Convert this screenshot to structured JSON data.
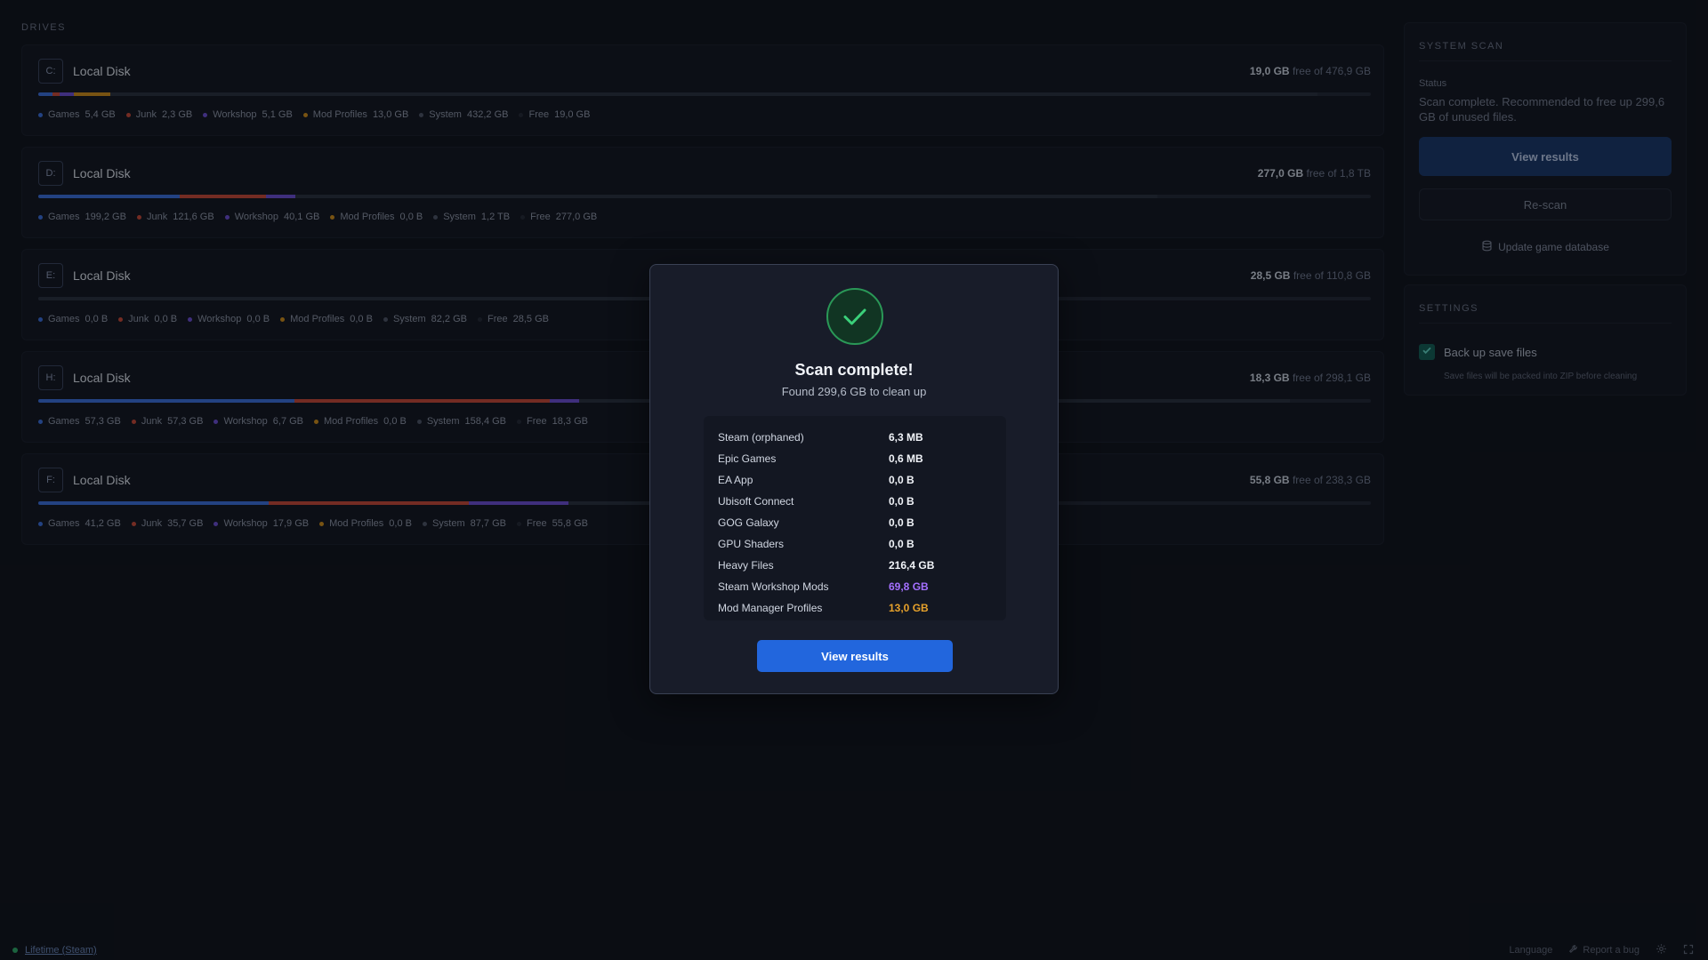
{
  "drives_section": {
    "label": "DRIVES"
  },
  "drives": [
    {
      "letter": "C:",
      "name": "Local Disk",
      "free_amount": "19,0 GB",
      "free_suffix": "free of 476,9 GB",
      "used_fraction": 0.96,
      "segments": [
        {
          "color": "#3b6fd9",
          "pct": 1.1
        },
        {
          "color": "#c24a3b",
          "pct": 0.5
        },
        {
          "color": "#6a4fd0",
          "pct": 1.1
        },
        {
          "color": "#c88a1e",
          "pct": 2.7
        },
        {
          "color": "#2b3242",
          "pct": 90.6
        }
      ],
      "legend": [
        {
          "label": "Games",
          "value": "5,4 GB",
          "color": "#3b6fd9"
        },
        {
          "label": "Junk",
          "value": "2,3 GB",
          "color": "#c24a3b"
        },
        {
          "label": "Workshop",
          "value": "5,1 GB",
          "color": "#6a4fd0"
        },
        {
          "label": "Mod Profiles",
          "value": "13,0 GB",
          "color": "#c88a1e"
        },
        {
          "label": "System",
          "value": "432,2 GB",
          "color": "#4d5568"
        },
        {
          "label": "Free",
          "value": "19,0 GB",
          "color": "#262c3a"
        }
      ]
    },
    {
      "letter": "D:",
      "name": "Local Disk",
      "free_amount": "277,0 GB",
      "free_suffix": "free of 1,8 TB",
      "used_fraction": 0.85,
      "segments": [
        {
          "color": "#3b6fd9",
          "pct": 10.6
        },
        {
          "color": "#c24a3b",
          "pct": 6.5
        },
        {
          "color": "#6a4fd0",
          "pct": 2.2
        },
        {
          "color": "#2b3242",
          "pct": 64.7
        }
      ],
      "legend": [
        {
          "label": "Games",
          "value": "199,2 GB",
          "color": "#3b6fd9"
        },
        {
          "label": "Junk",
          "value": "121,6 GB",
          "color": "#c24a3b"
        },
        {
          "label": "Workshop",
          "value": "40,1 GB",
          "color": "#6a4fd0"
        },
        {
          "label": "Mod Profiles",
          "value": "0,0 B",
          "color": "#c88a1e"
        },
        {
          "label": "System",
          "value": "1,2 TB",
          "color": "#4d5568"
        },
        {
          "label": "Free",
          "value": "277,0 GB",
          "color": "#262c3a"
        }
      ]
    },
    {
      "letter": "E:",
      "name": "Local Disk",
      "free_amount": "28,5 GB",
      "free_suffix": "free of 110,8 GB",
      "used_fraction": 0.74,
      "segments": [
        {
          "color": "#2b3242",
          "pct": 74.3
        }
      ],
      "legend": [
        {
          "label": "Games",
          "value": "0,0 B",
          "color": "#3b6fd9"
        },
        {
          "label": "Junk",
          "value": "0,0 B",
          "color": "#c24a3b"
        },
        {
          "label": "Workshop",
          "value": "0,0 B",
          "color": "#6a4fd0"
        },
        {
          "label": "Mod Profiles",
          "value": "0,0 B",
          "color": "#c88a1e"
        },
        {
          "label": "System",
          "value": "82,2 GB",
          "color": "#4d5568"
        },
        {
          "label": "Free",
          "value": "28,5 GB",
          "color": "#262c3a"
        }
      ]
    },
    {
      "letter": "H:",
      "name": "Local Disk",
      "free_amount": "18,3 GB",
      "free_suffix": "free of 298,1 GB",
      "used_fraction": 0.94,
      "segments": [
        {
          "color": "#3b6fd9",
          "pct": 19.2
        },
        {
          "color": "#c24a3b",
          "pct": 19.2
        },
        {
          "color": "#6a4fd0",
          "pct": 2.2
        },
        {
          "color": "#2b3242",
          "pct": 53.3
        }
      ],
      "legend": [
        {
          "label": "Games",
          "value": "57,3 GB",
          "color": "#3b6fd9"
        },
        {
          "label": "Junk",
          "value": "57,3 GB",
          "color": "#c24a3b"
        },
        {
          "label": "Workshop",
          "value": "6,7 GB",
          "color": "#6a4fd0"
        },
        {
          "label": "Mod Profiles",
          "value": "0,0 B",
          "color": "#c88a1e"
        },
        {
          "label": "System",
          "value": "158,4 GB",
          "color": "#4d5568"
        },
        {
          "label": "Free",
          "value": "18,3 GB",
          "color": "#262c3a"
        }
      ]
    },
    {
      "letter": "F:",
      "name": "Local Disk",
      "free_amount": "55,8 GB",
      "free_suffix": "free of 238,3 GB",
      "used_fraction": 0.77,
      "segments": [
        {
          "color": "#3b6fd9",
          "pct": 17.3
        },
        {
          "color": "#c24a3b",
          "pct": 15.0
        },
        {
          "color": "#6a4fd0",
          "pct": 7.5
        },
        {
          "color": "#2b3242",
          "pct": 36.8
        }
      ],
      "legend": [
        {
          "label": "Games",
          "value": "41,2 GB",
          "color": "#3b6fd9"
        },
        {
          "label": "Junk",
          "value": "35,7 GB",
          "color": "#c24a3b"
        },
        {
          "label": "Workshop",
          "value": "17,9 GB",
          "color": "#6a4fd0"
        },
        {
          "label": "Mod Profiles",
          "value": "0,0 B",
          "color": "#c88a1e"
        },
        {
          "label": "System",
          "value": "87,7 GB",
          "color": "#4d5568"
        },
        {
          "label": "Free",
          "value": "55,8 GB",
          "color": "#262c3a"
        }
      ]
    }
  ],
  "system_scan": {
    "label": "SYSTEM SCAN",
    "status_label": "Status",
    "status_text": "Scan complete. Recommended to free up 299,6 GB of unused files.",
    "view_results_label": "View results",
    "rescan_label": "Re-scan",
    "update_db_label": "Update game database"
  },
  "settings": {
    "label": "SETTINGS",
    "backup_label": "Back up save files",
    "backup_checked": true,
    "backup_desc": "Save files will be packed into ZIP before cleaning"
  },
  "footer": {
    "lifetime_label": "Lifetime (Steam)",
    "language_label": "Language",
    "report_bug_label": "Report a bug"
  },
  "modal": {
    "title": "Scan complete!",
    "subtitle": "Found 299,6 GB to clean up",
    "results": [
      {
        "name": "Steam (orphaned)",
        "value": "6,3 MB",
        "color": "#f1f4f9"
      },
      {
        "name": "Epic Games",
        "value": "0,6 MB",
        "color": "#f1f4f9"
      },
      {
        "name": "EA App",
        "value": "0,0 B",
        "color": "#f1f4f9"
      },
      {
        "name": "Ubisoft Connect",
        "value": "0,0 B",
        "color": "#f1f4f9"
      },
      {
        "name": "GOG Galaxy",
        "value": "0,0 B",
        "color": "#f1f4f9"
      },
      {
        "name": "GPU Shaders",
        "value": "0,0 B",
        "color": "#f1f4f9"
      },
      {
        "name": "Heavy Files",
        "value": "216,4 GB",
        "color": "#f1f4f9"
      },
      {
        "name": "Steam Workshop Mods",
        "value": "69,8 GB",
        "color": "#a470ff"
      },
      {
        "name": "Mod Manager Profiles",
        "value": "13,0 GB",
        "color": "#e6a12b"
      }
    ],
    "button_label": "View results"
  }
}
